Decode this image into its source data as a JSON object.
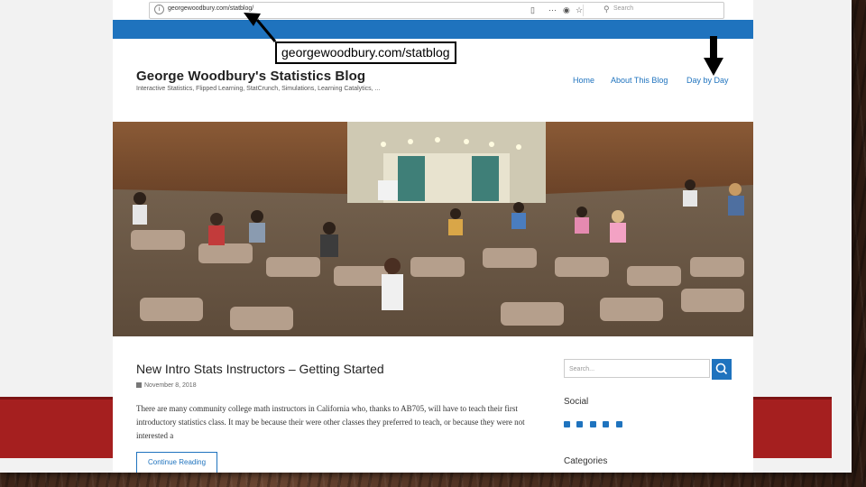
{
  "browser": {
    "url": "georgewoodbury.com/statblog/",
    "search_placeholder": "Search"
  },
  "site": {
    "title": "George Woodbury's Statistics Blog",
    "tagline": "Interactive Statistics, Flipped Learning, StatCrunch, Simulations, Learning Catalytics, ...",
    "nav": [
      "Home",
      "About This Blog",
      "Day by Day"
    ],
    "accent": "#1f73be"
  },
  "post": {
    "title": "New Intro Stats Instructors – Getting Started",
    "date": "November 8, 2018",
    "excerpt": "There are many community college math instructors in California who, thanks to AB705, will have to teach their first introductory statistics class. It may be because their were other classes they preferred to teach, or because they were not interested a",
    "continue_label": "Continue Reading"
  },
  "sidebar": {
    "search_placeholder": "Search...",
    "social_heading": "Social",
    "social_icons": [
      "facebook-icon",
      "twitter-icon",
      "instagram-icon",
      "linkedin-icon",
      "youtube-icon"
    ],
    "categories_heading": "Categories"
  },
  "annotation": {
    "callout": "georgewoodbury.com/statblog"
  },
  "slide": {
    "band_color": "#a51f1f"
  }
}
